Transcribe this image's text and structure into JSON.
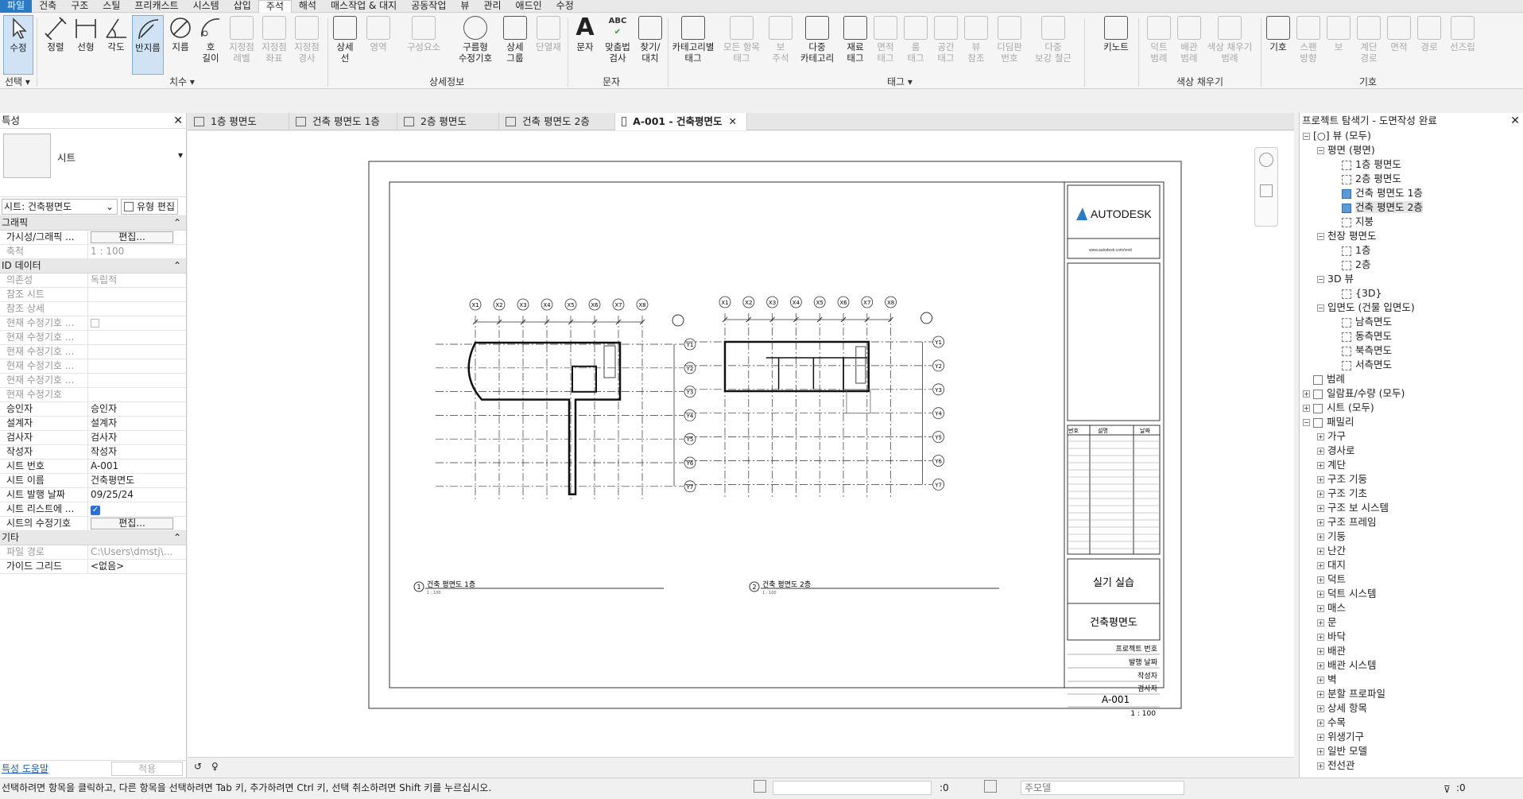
{
  "menu": {
    "items": [
      "파일",
      "건축",
      "구조",
      "스틸",
      "프리캐스트",
      "시스템",
      "삽입",
      "주석",
      "해석",
      "매스작업 & 대지",
      "공동작업",
      "뷰",
      "관리",
      "애드인",
      "수정"
    ]
  },
  "ribbon": {
    "buttons": {
      "modify": "수정",
      "aligned": "정렬",
      "linear": "선형",
      "angular": "각도",
      "radial": "반지름",
      "diameter": "지름",
      "arc_length": "호\n길이",
      "spot_elev": "지정점\n레벨",
      "spot_coord": "지정점\n좌표",
      "spot_slope": "지정점\n경사",
      "detail_line": "상세\n선",
      "region": "영역",
      "component": "구성요소",
      "revision_cloud": "구름형\n수정기호",
      "detail_group": "상세\n그룹",
      "insulation": "단열재",
      "text": "문자",
      "spelling": "맞춤법\n검사",
      "find_replace": "찾기/\n대치",
      "tag_by_cat": "카테고리별\n태그",
      "tag_all": "모든 항목\n태그",
      "beam_ann": "보\n주석",
      "multi_cat": "다중\n카테고리",
      "material_tag": "재료\n태그",
      "area_tag": "면적\n태그",
      "room_tag": "룸\n태그",
      "space_tag": "공간\n태그",
      "view_ref": "뷰\n참조",
      "tread_num": "디딤판\n번호",
      "multi_rebar": "다중\n보강 철근",
      "keynote": "키노트",
      "duct_legend": "덕트\n범례",
      "pipe_legend": "배관\n범례",
      "color_fill": "색상 채우기\n범례",
      "symbol": "기호",
      "span_dir": "스팬\n방향",
      "beam": "보",
      "stair_path": "계단\n경로",
      "area": "면적",
      "path": "경로",
      "rebar_sym": "선즈립"
    },
    "groups": {
      "select": "선택 ▾",
      "dimension": "치수 ▾",
      "detail": "상세정보",
      "text": "문자",
      "tag": "태그 ▾",
      "color_fill": "색상 채우기",
      "symbol": "기호"
    }
  },
  "properties": {
    "title": "특성",
    "type_name": "시트",
    "selector": "시트: 건축평면도",
    "edit_type": "유형 편집",
    "cat_graphics": "그래픽",
    "cat_id": "ID 데이터",
    "cat_other": "기타",
    "graphics": [
      {
        "k": "가시성/그래픽 ...",
        "v": "편집..."
      },
      {
        "k": "축척",
        "v": "1 : 100"
      }
    ],
    "id_data": [
      {
        "k": "의존성",
        "v": "독립적"
      },
      {
        "k": "참조 시트",
        "v": ""
      },
      {
        "k": "참조 상세",
        "v": ""
      },
      {
        "k": "현재 수정기호 ...",
        "v": "☐"
      },
      {
        "k": "현재 수정기호 ...",
        "v": ""
      },
      {
        "k": "현재 수정기호 ...",
        "v": ""
      },
      {
        "k": "현재 수정기호 ...",
        "v": ""
      },
      {
        "k": "현재 수정기호 ...",
        "v": ""
      },
      {
        "k": "현재 수정기호",
        "v": ""
      },
      {
        "k": "승인자",
        "v": "승인자"
      },
      {
        "k": "설계자",
        "v": "설계자"
      },
      {
        "k": "검사자",
        "v": "검사자"
      },
      {
        "k": "작성자",
        "v": "작성자"
      },
      {
        "k": "시트 번호",
        "v": "A-001"
      },
      {
        "k": "시트 이름",
        "v": "건축평면도"
      },
      {
        "k": "시트 발행 날짜",
        "v": "09/25/24"
      },
      {
        "k": "시트 리스트에 ...",
        "v": "☑"
      },
      {
        "k": "시트의 수정기호",
        "v": "편집..."
      }
    ],
    "other": [
      {
        "k": "파일 경로",
        "v": "C:\\Users\\dmstj\\..."
      },
      {
        "k": "가이드 그리드",
        "v": "<없음>"
      }
    ],
    "help": "특성 도움말",
    "apply": "적용"
  },
  "tabs": [
    "1층 평면도",
    "건축 평면도 1층",
    "2층 평면도",
    "건축 평면도 2층",
    "A-001 - 건축평면도"
  ],
  "sheet": {
    "logo": "AUTODESK",
    "website": "www.autodesk.com/revit",
    "rev_headers": [
      "번호",
      "설명",
      "날짜"
    ],
    "project": "실기 실습",
    "sheet_name": "건축평면도",
    "proj_num_label": "프로젝트 번호",
    "issue_date_label": "발행 날짜",
    "drawn_label": "작성자",
    "checked_label": "검사자",
    "number": "A-001",
    "scale": "1 : 100",
    "view1_num": "1",
    "view1_title": "건축 평면도 1층",
    "view1_scale": "1 : 100",
    "view2_num": "2",
    "view2_title": "건축 평면도 2층",
    "view2_scale": "1 : 100",
    "grid_x": [
      "X1",
      "X2",
      "X3",
      "X4",
      "X5",
      "X6",
      "X7",
      "X8"
    ],
    "grid_y": [
      "Y1",
      "Y2",
      "Y3",
      "Y4",
      "Y5",
      "Y6",
      "Y7"
    ]
  },
  "browser": {
    "title": "프로젝트 탐색기 - 도면작성 완료",
    "nodes": [
      {
        "lvl": 0,
        "tg": "−",
        "ic": "view",
        "t": "[○] 뷰 (모두)"
      },
      {
        "lvl": 1,
        "tg": "−",
        "ic": "",
        "t": "평면 (평면)"
      },
      {
        "lvl": 2,
        "tg": "",
        "ic": "v",
        "t": "1층 평면도"
      },
      {
        "lvl": 2,
        "tg": "",
        "ic": "v",
        "t": "2층 평면도"
      },
      {
        "lvl": 2,
        "tg": "",
        "ic": "on",
        "t": "건축 평면도 1층"
      },
      {
        "lvl": 2,
        "tg": "",
        "ic": "on",
        "t": "건축 평면도 2층",
        "hl": true
      },
      {
        "lvl": 2,
        "tg": "",
        "ic": "v",
        "t": "지붕"
      },
      {
        "lvl": 1,
        "tg": "−",
        "ic": "",
        "t": "천장 평면도"
      },
      {
        "lvl": 2,
        "tg": "",
        "ic": "v",
        "t": "1층"
      },
      {
        "lvl": 2,
        "tg": "",
        "ic": "v",
        "t": "2층"
      },
      {
        "lvl": 1,
        "tg": "−",
        "ic": "",
        "t": "3D 뷰"
      },
      {
        "lvl": 2,
        "tg": "",
        "ic": "v",
        "t": "{3D}"
      },
      {
        "lvl": 1,
        "tg": "−",
        "ic": "",
        "t": "입면도 (건물 입면도)"
      },
      {
        "lvl": 2,
        "tg": "",
        "ic": "v",
        "t": "남측면도"
      },
      {
        "lvl": 2,
        "tg": "",
        "ic": "v",
        "t": "동측면도"
      },
      {
        "lvl": 2,
        "tg": "",
        "ic": "v",
        "t": "북측면도"
      },
      {
        "lvl": 2,
        "tg": "",
        "ic": "v",
        "t": "서측면도"
      },
      {
        "lvl": 0,
        "tg": "",
        "ic": "box",
        "t": "범례"
      },
      {
        "lvl": 0,
        "tg": "+",
        "ic": "box",
        "t": "일람표/수량 (모두)"
      },
      {
        "lvl": 0,
        "tg": "+",
        "ic": "box",
        "t": "시트 (모두)"
      },
      {
        "lvl": 0,
        "tg": "−",
        "ic": "box",
        "t": "패밀리"
      },
      {
        "lvl": 1,
        "tg": "+",
        "ic": "",
        "t": "가구"
      },
      {
        "lvl": 1,
        "tg": "+",
        "ic": "",
        "t": "경사로"
      },
      {
        "lvl": 1,
        "tg": "+",
        "ic": "",
        "t": "계단"
      },
      {
        "lvl": 1,
        "tg": "+",
        "ic": "",
        "t": "구조 기둥"
      },
      {
        "lvl": 1,
        "tg": "+",
        "ic": "",
        "t": "구조 기초"
      },
      {
        "lvl": 1,
        "tg": "+",
        "ic": "",
        "t": "구조 보 시스템"
      },
      {
        "lvl": 1,
        "tg": "+",
        "ic": "",
        "t": "구조 프레임"
      },
      {
        "lvl": 1,
        "tg": "+",
        "ic": "",
        "t": "기둥"
      },
      {
        "lvl": 1,
        "tg": "+",
        "ic": "",
        "t": "난간"
      },
      {
        "lvl": 1,
        "tg": "+",
        "ic": "",
        "t": "대지"
      },
      {
        "lvl": 1,
        "tg": "+",
        "ic": "",
        "t": "덕트"
      },
      {
        "lvl": 1,
        "tg": "+",
        "ic": "",
        "t": "덕트 시스템"
      },
      {
        "lvl": 1,
        "tg": "+",
        "ic": "",
        "t": "매스"
      },
      {
        "lvl": 1,
        "tg": "+",
        "ic": "",
        "t": "문"
      },
      {
        "lvl": 1,
        "tg": "+",
        "ic": "",
        "t": "바닥"
      },
      {
        "lvl": 1,
        "tg": "+",
        "ic": "",
        "t": "배관"
      },
      {
        "lvl": 1,
        "tg": "+",
        "ic": "",
        "t": "배관 시스템"
      },
      {
        "lvl": 1,
        "tg": "+",
        "ic": "",
        "t": "벽"
      },
      {
        "lvl": 1,
        "tg": "+",
        "ic": "",
        "t": "분할 프로파일"
      },
      {
        "lvl": 1,
        "tg": "+",
        "ic": "",
        "t": "상세 항목"
      },
      {
        "lvl": 1,
        "tg": "+",
        "ic": "",
        "t": "수목"
      },
      {
        "lvl": 1,
        "tg": "+",
        "ic": "",
        "t": "위생기구"
      },
      {
        "lvl": 1,
        "tg": "+",
        "ic": "",
        "t": "일반 모델"
      },
      {
        "lvl": 1,
        "tg": "+",
        "ic": "",
        "t": "전선관"
      }
    ]
  },
  "status": {
    "message": "선택하려면 항목을 클릭하고, 다른 항목을 선택하려면 Tab 키, 추가하려면 Ctrl 키, 선택 취소하려면 Shift 키를 누르십시오.",
    "zero1": ":0",
    "model": "주모델",
    "zero2": ":0"
  }
}
